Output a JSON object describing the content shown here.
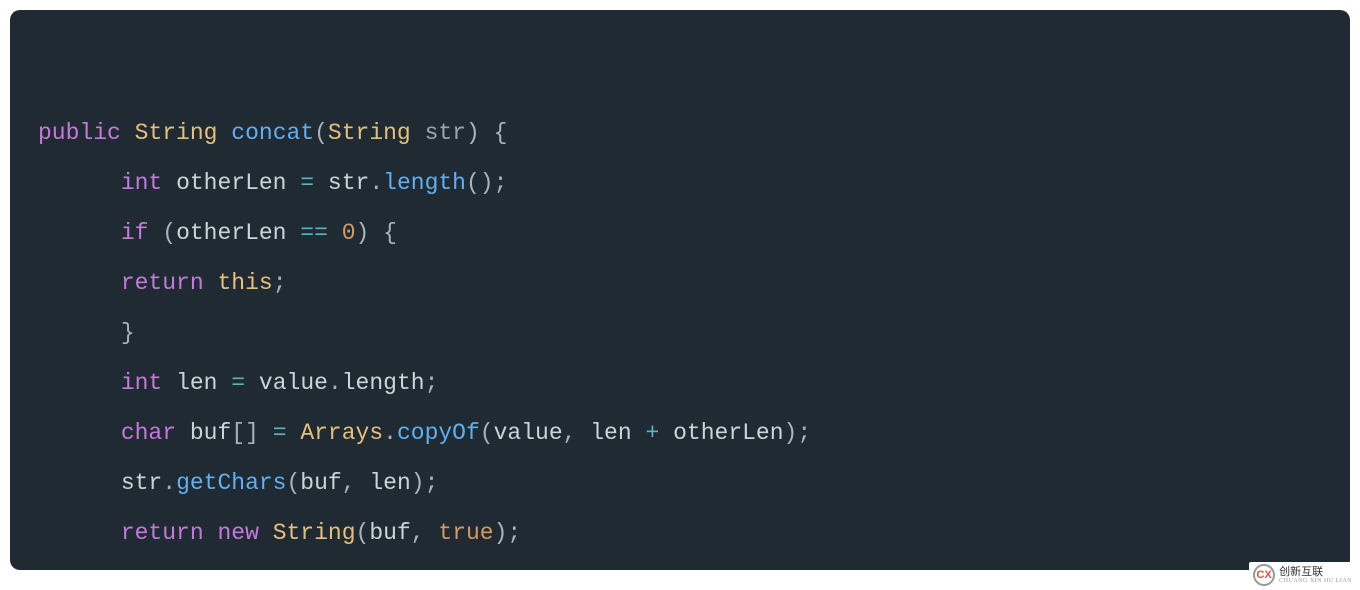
{
  "code": {
    "l1": {
      "kw_public": "public",
      "type_string": "String",
      "method": "concat",
      "type_string2": "String",
      "param": "str",
      "paren_open": "(",
      "paren_close": ")",
      "brace_open": "{"
    },
    "l2": {
      "kw_int": "int",
      "ident_otherLen": "otherLen",
      "op_assign": "=",
      "ident_str": "str",
      "dot": ".",
      "method_length": "length",
      "parens": "()",
      "semi": ";"
    },
    "l3": {
      "kw_if": "if",
      "paren_open": "(",
      "ident_otherLen": "otherLen",
      "op_eq": "==",
      "num_zero": "0",
      "paren_close": ")",
      "brace_open": "{"
    },
    "l4": {
      "kw_return": "return",
      "kw_this": "this",
      "semi": ";"
    },
    "l5": {
      "brace_close": "}"
    },
    "l6": {
      "kw_int": "int",
      "ident_len": "len",
      "op_assign": "=",
      "ident_value": "value",
      "dot": ".",
      "prop_length": "length",
      "semi": ";"
    },
    "l7": {
      "kw_char": "char",
      "ident_buf": "buf",
      "brackets": "[]",
      "op_assign": "=",
      "class_arrays": "Arrays",
      "dot": ".",
      "method_copyOf": "copyOf",
      "paren_open": "(",
      "ident_value": "value",
      "comma": ",",
      "ident_len": "len",
      "op_plus": "+",
      "ident_otherLen": "otherLen",
      "paren_close": ")",
      "semi": ";"
    },
    "l8": {
      "ident_str": "str",
      "dot": ".",
      "method_getChars": "getChars",
      "paren_open": "(",
      "ident_buf": "buf",
      "comma": ",",
      "ident_len": "len",
      "paren_close": ")",
      "semi": ";"
    },
    "l9": {
      "kw_return": "return",
      "kw_new": "new",
      "class_string": "String",
      "paren_open": "(",
      "ident_buf": "buf",
      "comma": ",",
      "bool_true": "true",
      "paren_close": ")",
      "semi": ";"
    },
    "l10": {
      "brace_close": "}"
    }
  },
  "watermark": {
    "logo_text": "CX",
    "main": "创新互联",
    "sub": "CHUANG XIN HU LIAN"
  }
}
